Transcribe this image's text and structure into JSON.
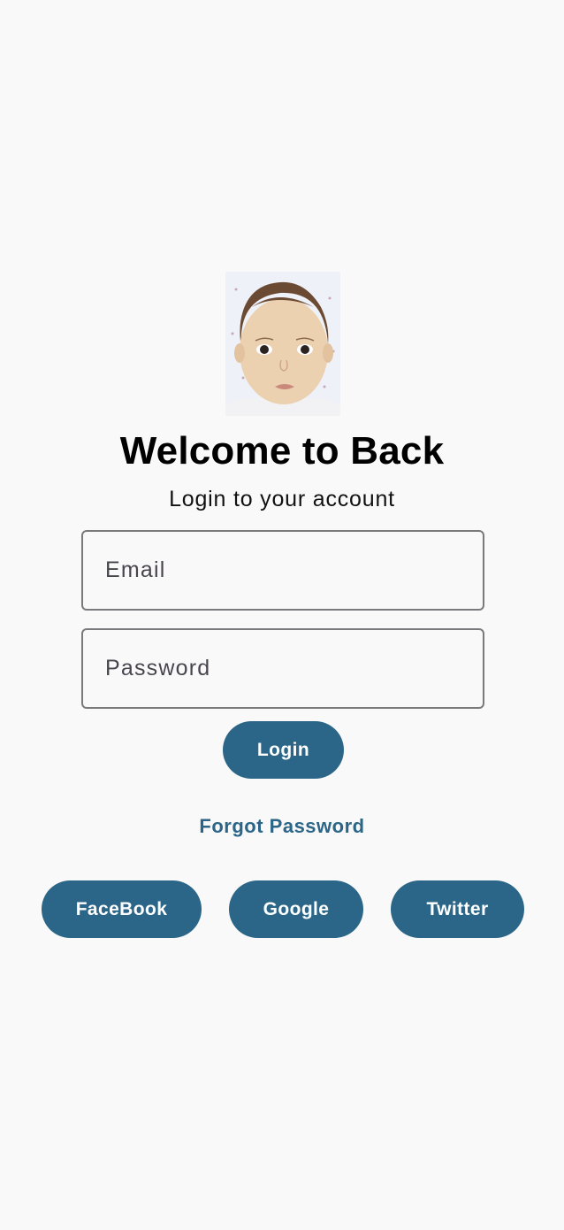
{
  "header": {
    "title": "Welcome to Back",
    "subtitle": "Login to your account"
  },
  "form": {
    "email_placeholder": "Email",
    "password_placeholder": "Password",
    "login_label": "Login",
    "forgot_label": "Forgot Password"
  },
  "social": {
    "facebook_label": "FaceBook",
    "google_label": "Google",
    "twitter_label": "Twitter"
  },
  "colors": {
    "primary": "#2b6688",
    "background": "#f9f9f9",
    "field_border": "#7a7a7c"
  }
}
